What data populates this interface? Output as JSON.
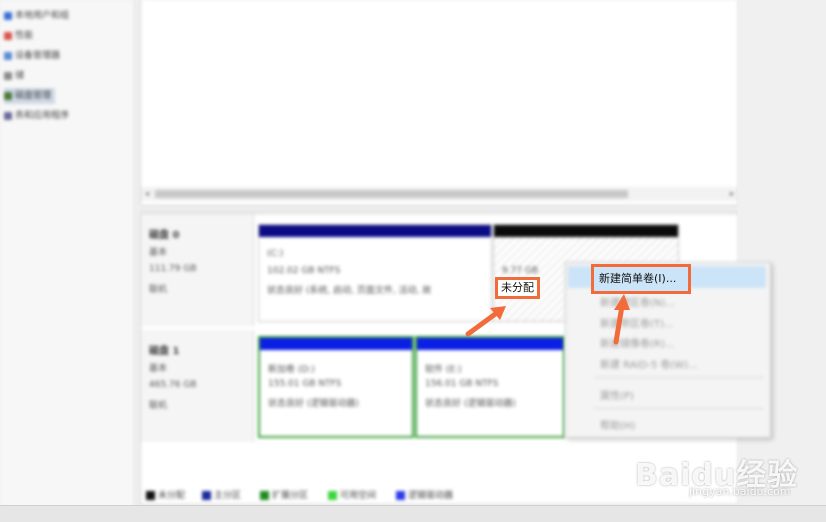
{
  "sidebar": {
    "items": [
      {
        "label": "本地用户和组",
        "color": "#3a6fd8"
      },
      {
        "label": "性能",
        "color": "#d9534f"
      },
      {
        "label": "设备管理器",
        "color": "#5a8ad6"
      },
      {
        "label": "储",
        "color": "#8a8a8a"
      },
      {
        "label": "磁盘管理",
        "color": "#4a7a3a"
      },
      {
        "label": "务和应用程序",
        "color": "#6a6a9a"
      }
    ]
  },
  "disks": [
    {
      "name": "磁盘 0",
      "type": "基本",
      "size": "111.79 GB",
      "status": "联机",
      "partitions": [
        {
          "title": "(C:)",
          "detail": "102.02 GB NTFS",
          "health": "状态良好 (系统, 启动, 页面文件, 活动, 故",
          "bar_color": "#0b0b86"
        },
        {
          "title": "",
          "detail": "9.77 GB",
          "health": "",
          "bar_color": "#0a0a0a"
        }
      ]
    },
    {
      "name": "磁盘 1",
      "type": "基本",
      "size": "465.76 GB",
      "status": "联机",
      "partitions": [
        {
          "title": "新加卷 (D:)",
          "detail": "155.01 GB NTFS",
          "health": "状态良好 (逻辑驱动器)",
          "bar_color": "#0a1ee6"
        },
        {
          "title": "软件 (E:)",
          "detail": "156.01 GB NTFS",
          "health": "状态良好 (逻辑驱动器)",
          "bar_color": "#0a1ee6"
        }
      ]
    }
  ],
  "legend": [
    {
      "label": "未分配",
      "color": "#111111"
    },
    {
      "label": "主分区",
      "color": "#1a2a9a"
    },
    {
      "label": "扩展分区",
      "color": "#1e8a1e"
    },
    {
      "label": "可用空间",
      "color": "#3ad43a"
    },
    {
      "label": "逻辑驱动器",
      "color": "#2a3ae6"
    }
  ],
  "context_menu": {
    "items": [
      "新建简单卷(I)...",
      "新建跨区卷(N)...",
      "新建带区卷(T)...",
      "新建镜像卷(R)...",
      "新建 RAID-5 卷(W)...",
      "属性(P)",
      "帮助(H)"
    ]
  },
  "annotations": {
    "unallocated": "未分配",
    "new_simple_volume": "新建简单卷(I)...",
    "highlight_color": "#f26b3a"
  },
  "watermark": {
    "brand": "Baidu经验",
    "url": "jingyan.baidu.com"
  }
}
